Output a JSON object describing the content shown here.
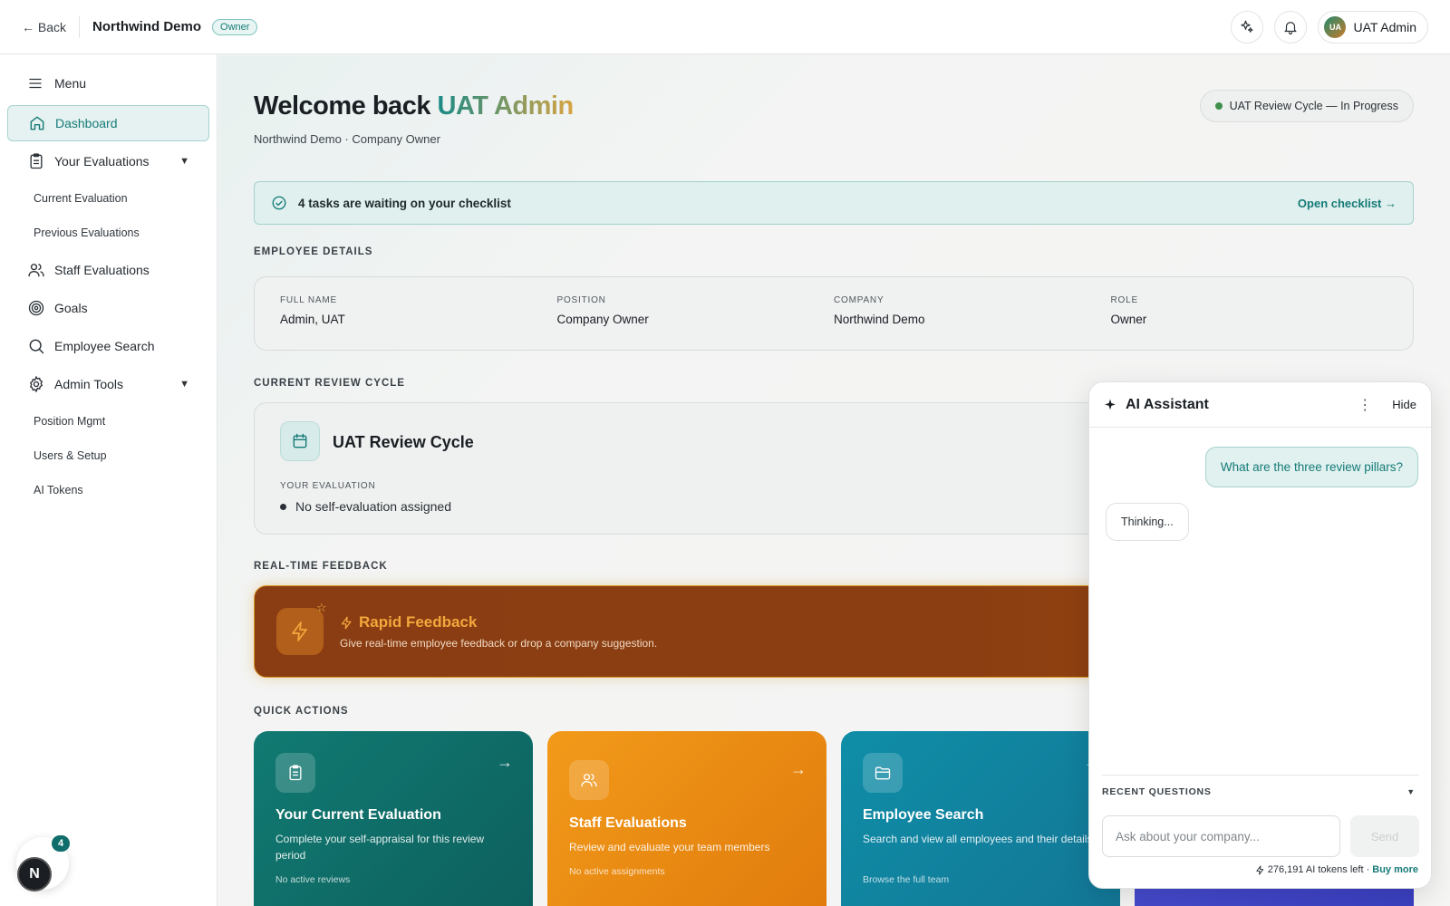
{
  "topbar": {
    "back_label": "← Back",
    "company": "Northwind Demo",
    "role_badge": "Owner",
    "user_initials": "UA",
    "user_name": "UAT Admin"
  },
  "sidebar": {
    "menu_label": "Menu",
    "items": [
      {
        "label": "Dashboard",
        "icon": "home-icon",
        "active": true
      },
      {
        "label": "Your Evaluations",
        "icon": "clipboard-icon",
        "caret": "▼"
      },
      {
        "label": "Current Evaluation"
      },
      {
        "label": "Previous Evaluations"
      },
      {
        "label": "Staff Evaluations",
        "icon": "users-icon"
      },
      {
        "label": "Goals",
        "icon": "target-icon"
      },
      {
        "label": "Employee Search",
        "icon": "search-icon"
      },
      {
        "label": "Admin Tools",
        "icon": "gear-icon",
        "caret": "▼"
      },
      {
        "label": "Position Mgmt"
      },
      {
        "label": "Users & Setup"
      },
      {
        "label": "AI Tokens"
      }
    ]
  },
  "main": {
    "welcome_prefix": "Welcome back",
    "welcome_name": "UAT Admin",
    "subtitle": "Northwind Demo · Company Owner",
    "cycle_pill": "UAT Review Cycle — In Progress",
    "checklist": {
      "text": "4 tasks are waiting on your checklist",
      "link": "Open checklist →"
    },
    "employee_details": {
      "heading": "EMPLOYEE DETAILS",
      "fields": [
        {
          "key": "FULL NAME",
          "value": "Admin, UAT"
        },
        {
          "key": "POSITION",
          "value": "Company Owner"
        },
        {
          "key": "COMPANY",
          "value": "Northwind Demo"
        },
        {
          "key": "ROLE",
          "value": "Owner"
        }
      ]
    },
    "review_cycle": {
      "heading": "CURRENT REVIEW CYCLE",
      "title": "UAT Review Cycle",
      "sub_label": "YOUR EVALUATION",
      "status": "No self-evaluation assigned"
    },
    "feedback": {
      "heading": "REAL-TIME FEEDBACK",
      "title": "Rapid Feedback",
      "description": "Give real-time employee feedback or drop a company suggestion."
    },
    "quick_actions": {
      "heading": "QUICK ACTIONS",
      "cards": [
        {
          "title": "Your Current Evaluation",
          "description": "Complete your self-appraisal for this review period",
          "footer": "No active reviews",
          "icon": "clipboard-icon",
          "arrow": "→"
        },
        {
          "title": "Staff Evaluations",
          "description": "Review and evaluate your team members",
          "footer": "No active assignments",
          "icon": "users-icon",
          "arrow": "→"
        },
        {
          "title": "Employee Search",
          "description": "Search and view all employees and their details",
          "footer": "Browse the full team",
          "icon": "folder-icon",
          "arrow": "→"
        }
      ]
    }
  },
  "ai_assistant": {
    "title": "AI Assistant",
    "menu_glyph": "⋮",
    "hide_label": "Hide",
    "user_message": "What are the three review pillars?",
    "bot_message": "Thinking...",
    "recent_label": "RECENT QUESTIONS",
    "input_placeholder": "Ask about your company...",
    "send_label": "Send",
    "tokens_text": "276,191 AI tokens left ·",
    "buy_label": "Buy more"
  },
  "floating": {
    "letter": "N",
    "count": "4"
  },
  "colors": {
    "accent": "#167b78",
    "rapid_bg": "#8a3d12",
    "rapid_title": "#f3a73c"
  }
}
